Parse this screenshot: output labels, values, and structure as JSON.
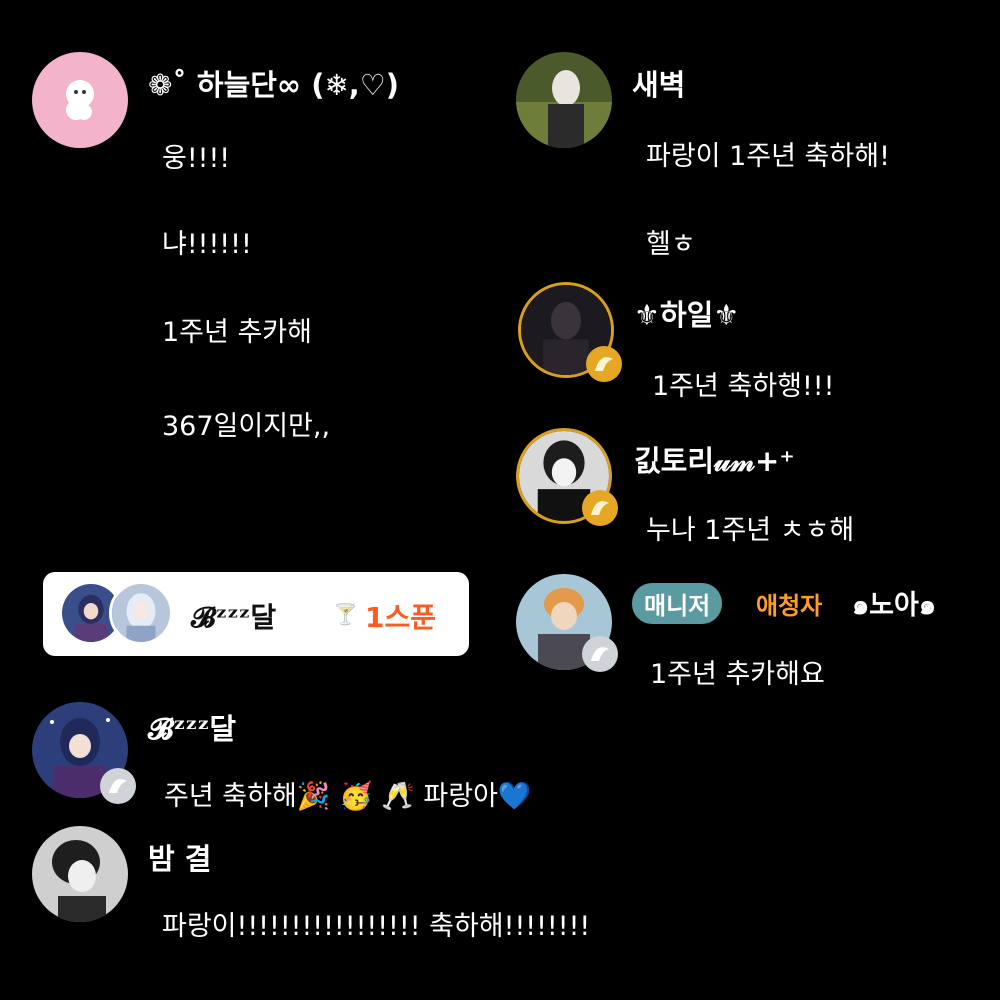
{
  "messages": [
    {
      "user": "❁˚ 하늘단∞ (❄,♡)",
      "lines": [
        "웅!!!!",
        "냐!!!!!!",
        "1주년 추카해",
        "367일이지만,,"
      ]
    },
    {
      "user": "새벽",
      "lines": [
        "파랑이 1주년 축하해!",
        "헬ㅎ"
      ]
    },
    {
      "user": "⚜하일⚜",
      "lines": [
        "1주년 축하행!!!"
      ]
    },
    {
      "user": "긼토리𝓊𝓂+⁺",
      "lines": [
        "누나 1주년 ㅊㅎ해"
      ]
    },
    {
      "user": "๑노아๑",
      "roles": [
        "매니저",
        "애청자"
      ],
      "lines": [
        "1주년 추카해요"
      ]
    },
    {
      "user": "𝓑ᶻᶻᶻ달",
      "lines": [
        "주년 축하해🎉 🥳 🥂 파랑아💙"
      ]
    },
    {
      "user": "밤 결",
      "lines": [
        "파랑이!!!!!!!!!!!!!!!!! 축하해!!!!!!!!"
      ]
    }
  ],
  "card": {
    "name": "𝓑ᶻᶻᶻ달",
    "glass": "🍸",
    "spoon": "1스푼"
  },
  "colors": {
    "background": "#000000",
    "gold_ring": "#d9a01e",
    "manager_chip": "#5b9aa0",
    "curator_text": "#ff9d2a",
    "spoon_text": "#ff5a1f"
  }
}
